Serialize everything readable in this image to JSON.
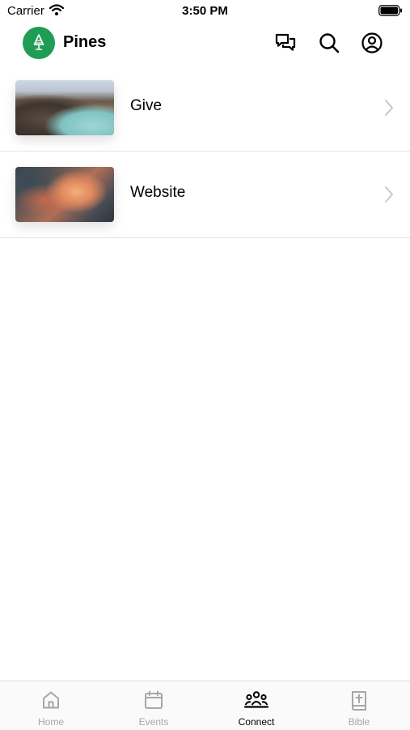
{
  "status_bar": {
    "carrier": "Carrier",
    "time": "3:50 PM"
  },
  "header": {
    "title": "Pines",
    "icons": [
      "chat-icon",
      "search-icon",
      "profile-icon"
    ],
    "logo_color": "#1f9d55"
  },
  "list": [
    {
      "label": "Give",
      "thumbnail": "lake-landscape-photo"
    },
    {
      "label": "Website",
      "thumbnail": "sunset-clouds-photo"
    }
  ],
  "tabs": [
    {
      "label": "Home",
      "icon": "home-icon",
      "active": false
    },
    {
      "label": "Events",
      "icon": "calendar-icon",
      "active": false
    },
    {
      "label": "Connect",
      "icon": "people-icon",
      "active": true
    },
    {
      "label": "Bible",
      "icon": "bible-icon",
      "active": false
    }
  ]
}
